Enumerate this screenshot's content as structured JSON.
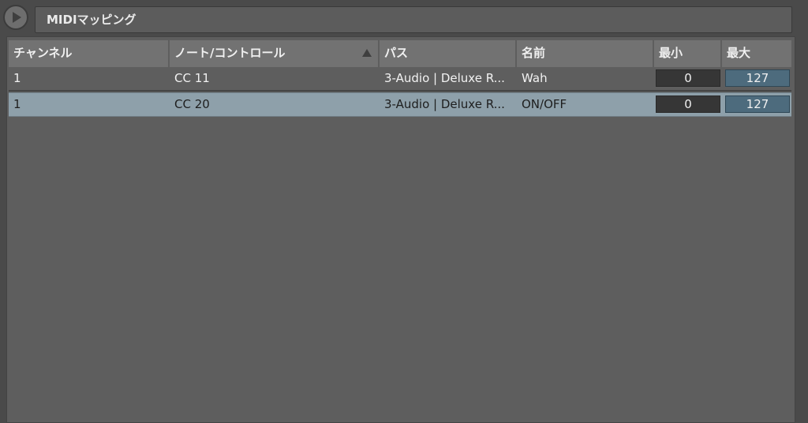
{
  "window": {
    "title": "MIDIマッピング"
  },
  "table": {
    "columns": [
      {
        "key": "channel",
        "label": "チャンネル"
      },
      {
        "key": "note",
        "label": "ノート/コントロール"
      },
      {
        "key": "path",
        "label": "パス"
      },
      {
        "key": "name",
        "label": "名前"
      },
      {
        "key": "min",
        "label": "最小"
      },
      {
        "key": "max",
        "label": "最大"
      }
    ],
    "sorted_column": "note",
    "rows": [
      {
        "channel": "1",
        "note": "CC 11",
        "path": "3-Audio | Deluxe R...",
        "name": "Wah",
        "min": "0",
        "max": "127",
        "selected": false
      },
      {
        "channel": "1",
        "note": "CC 20",
        "path": "3-Audio | Deluxe R...",
        "name": "ON/OFF",
        "min": "0",
        "max": "127",
        "selected": true
      }
    ]
  },
  "colors": {
    "background": "#4a4a4a",
    "header": "#727272",
    "selected_row": "#8ea0aa",
    "max_field": "#4d6b7d",
    "min_field": "#363636"
  }
}
